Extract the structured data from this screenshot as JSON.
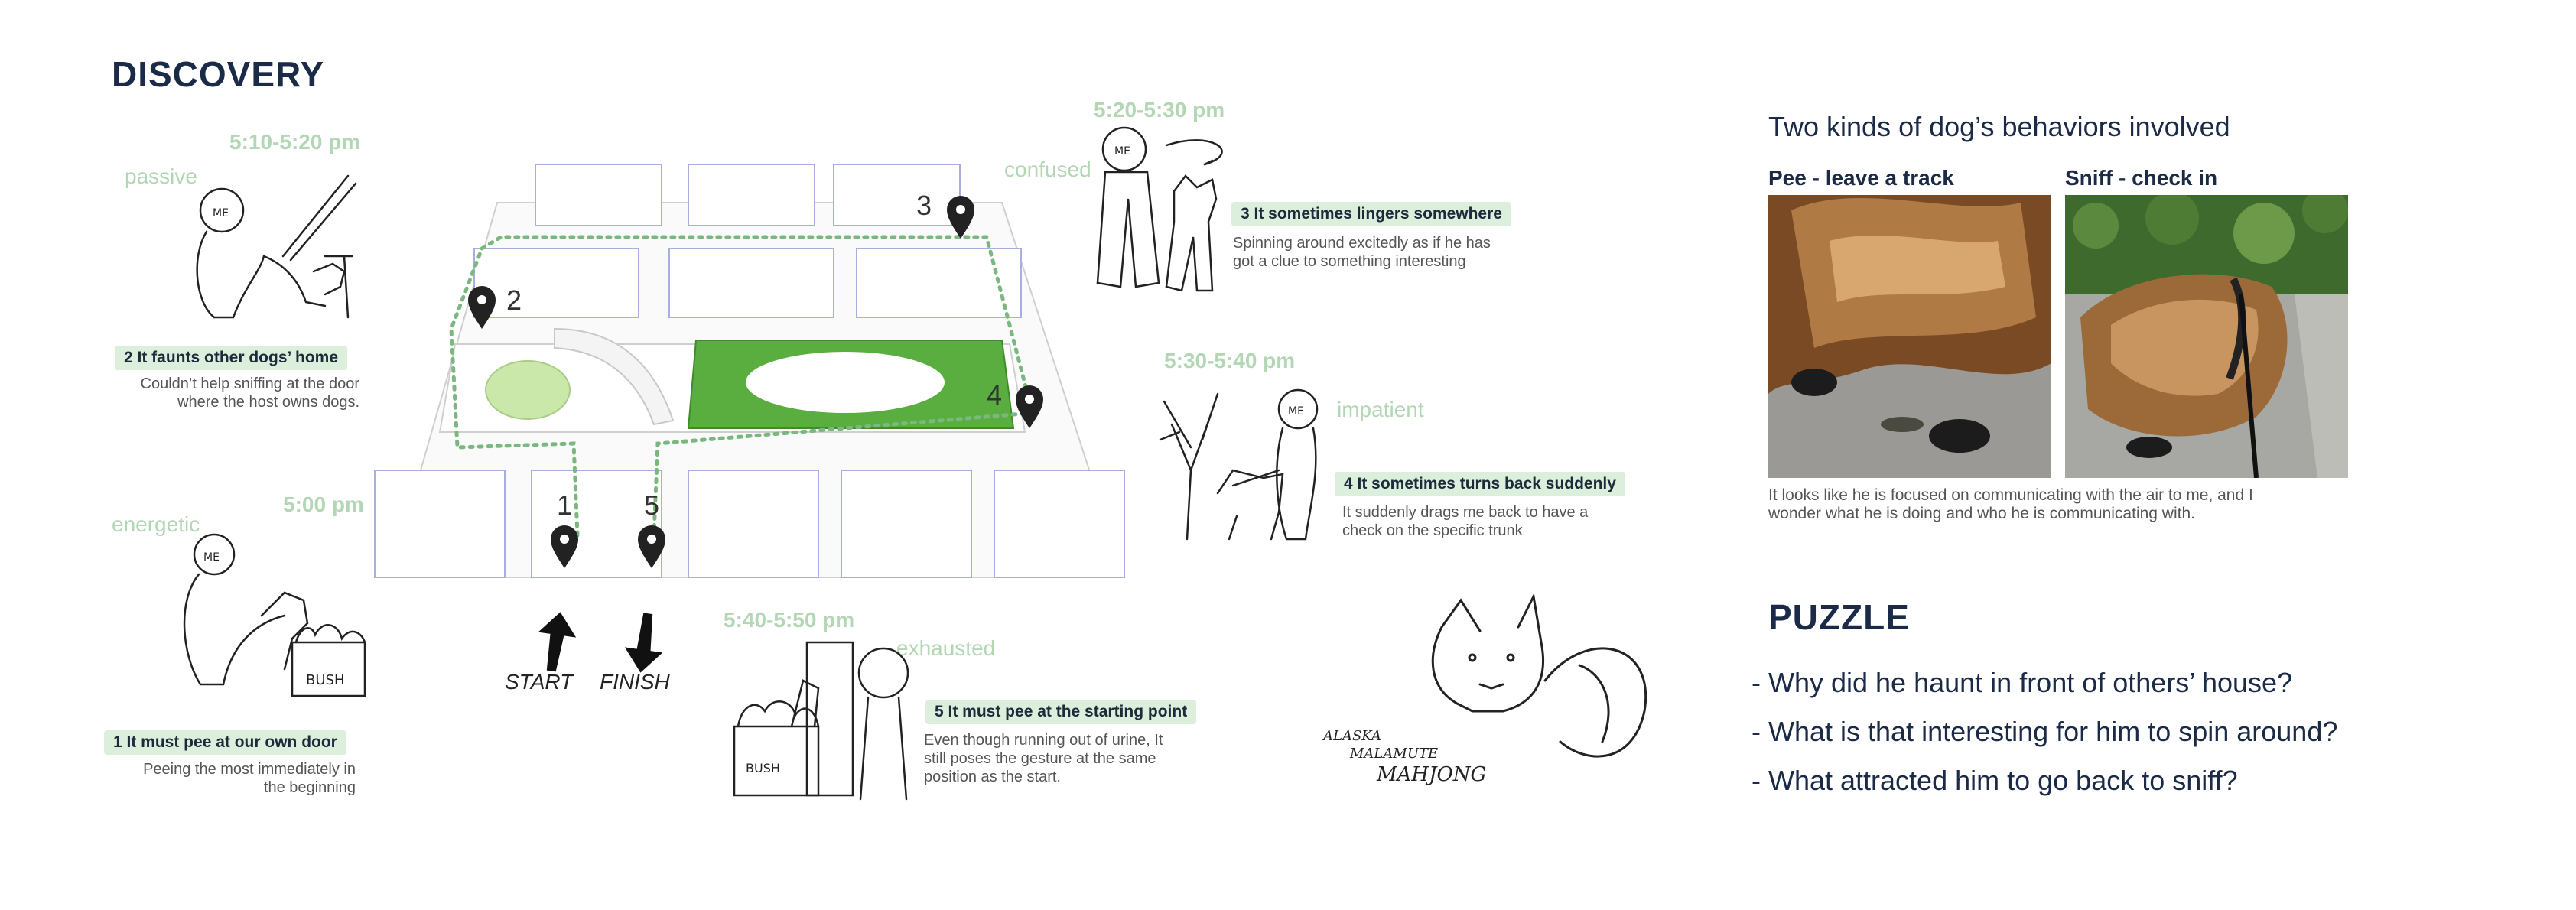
{
  "discovery": {
    "title": "DISCOVERY",
    "times": {
      "t1": "5:10-5:20 pm",
      "t2": "5:20-5:30 pm",
      "t3": "5:30-5:40 pm",
      "t4": "5:00 pm",
      "t5": "5:40-5:50 pm"
    },
    "moods": {
      "passive": "passive",
      "confused": "confused",
      "impatient": "impatient",
      "energetic": "energetic",
      "exhausted": "exhausted"
    },
    "behaviors": [
      {
        "tag": "2 It faunts other dogs’ home",
        "desc": [
          "Couldn’t help sniffing at the door",
          "where the host owns dogs."
        ]
      },
      {
        "tag": "3 It sometimes lingers somewhere",
        "desc": [
          "Spinning around excitedly as if he has",
          "got a clue to something interesting"
        ]
      },
      {
        "tag": "4 It sometimes turns back suddenly",
        "desc": [
          "It suddenly drags me back to have a",
          "check on the specific trunk"
        ]
      },
      {
        "tag": "1 It must pee at our own door",
        "desc": [
          "Peeing the most immediately in",
          "the beginning"
        ]
      },
      {
        "tag": "5 It must pee at the starting point",
        "desc": [
          "Even though running out of urine, It",
          "still poses the gesture at the same",
          "position as the start."
        ]
      }
    ],
    "pins": [
      "1",
      "2",
      "3",
      "4",
      "5"
    ],
    "start_label": "START",
    "finish_label": "FINISH",
    "sketch_labels": {
      "me": "ME",
      "bush": "BUSH",
      "dog_line1": "ALASKA",
      "dog_line2": "MALAMUTE",
      "dog_name": "MAHJONG"
    }
  },
  "behaviors_panel": {
    "title": "Two kinds of dog’s behaviors involved",
    "photo_labels": [
      "Pee - leave a track",
      "Sniff - check in"
    ],
    "caption": [
      "It looks like he is focused on communicating with the air to me, and I",
      "wonder what he is doing and who he is communicating with."
    ]
  },
  "puzzle": {
    "title": "PUZZLE",
    "questions": [
      "- Why did he haunt in front of others’ house?",
      "- What is that interesting for him to spin around?",
      "- What attracted him to go back to sniff?"
    ]
  },
  "colors": {
    "accent_green": "#5aad3f",
    "tag_bg": "#dcefdc",
    "time_green": "#b3d6b5",
    "navy": "#1a2a47"
  }
}
